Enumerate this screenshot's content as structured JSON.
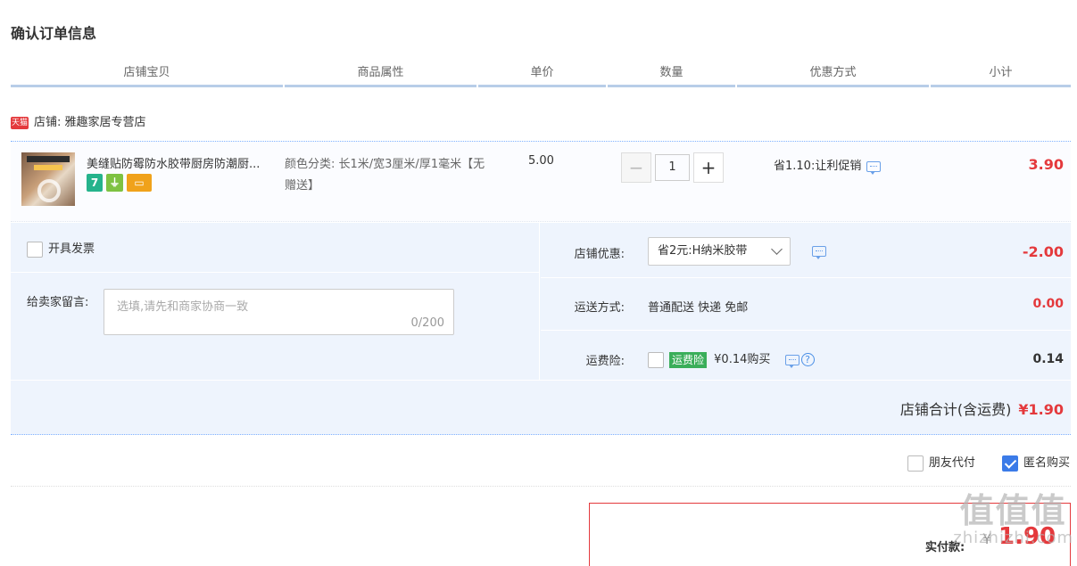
{
  "page_title": "确认订单信息",
  "columns": [
    "店铺宝贝",
    "商品属性",
    "单价",
    "数量",
    "优惠方式",
    "小计"
  ],
  "shop": {
    "tag": "天猫",
    "label": "店铺:",
    "name": "雅趣家居专营店"
  },
  "item": {
    "name": "美缝贴防霉防水胶带厨房防潮厨...",
    "attr": "颜色分类: 长1米/宽3厘米/厚1毫米【无赠送】",
    "price": "5.00",
    "qty": "1",
    "promo": "省1.10:让利促销",
    "subtotal": "3.90",
    "badge_7": "7"
  },
  "invoice_label": "开具发票",
  "message": {
    "label": "给卖家留言:",
    "placeholder": "选填,请先和商家协商一致",
    "count": "0/200"
  },
  "shop_discount": {
    "label": "店铺优惠:",
    "selected": "省2元:H纳米胶带",
    "value": "-2.00"
  },
  "shipping": {
    "label": "运送方式:",
    "text": "普通配送 快递 免邮",
    "value": "0.00"
  },
  "insurance": {
    "label": "运费险:",
    "tag": "运费险",
    "text": "¥0.14购买",
    "help": "?",
    "value": "0.14"
  },
  "shop_total": {
    "label": "店铺合计(含运费)",
    "value": "¥1.90"
  },
  "extras": {
    "friend_pay": "朋友代付",
    "anonymous": "匿名购买"
  },
  "payment": {
    "label": "实付款:",
    "yen": "¥",
    "amount": "1.90"
  },
  "watermark": {
    "big": "值值值",
    "small": "zhizhizhi.com"
  },
  "colors": {
    "accent_red": "#e4393c",
    "header_border": "#b8cde8",
    "panel_bg": "#eef4fd",
    "checkbox_blue": "#3b7be8",
    "tag_green": "#3aae5a"
  }
}
